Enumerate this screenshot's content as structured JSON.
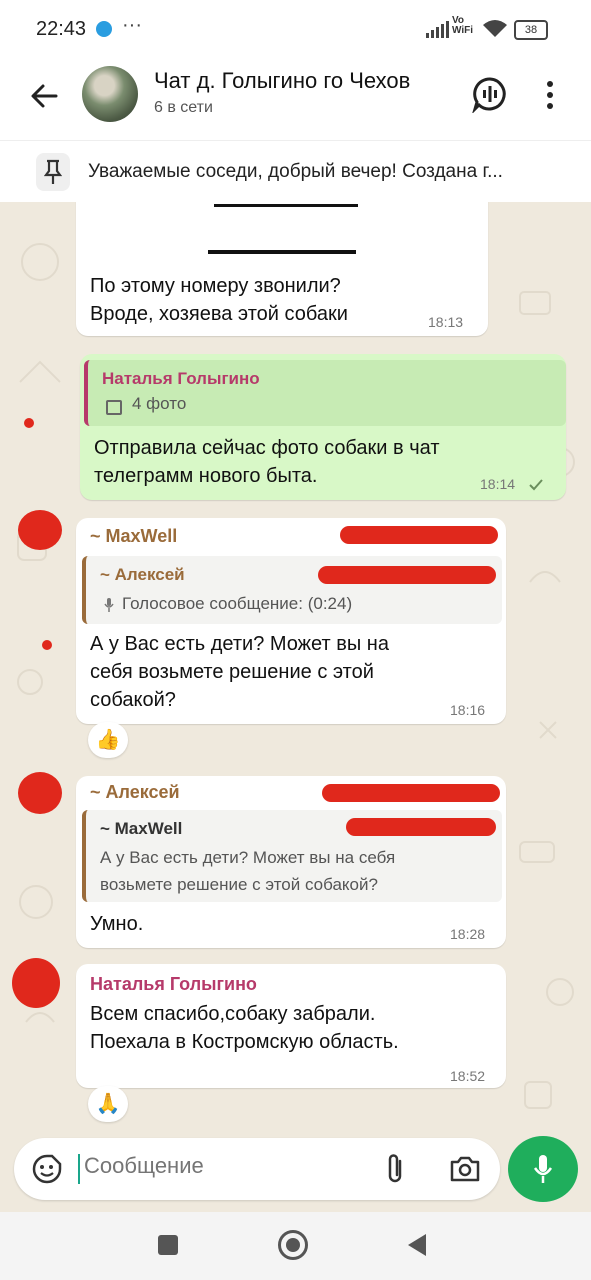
{
  "status_bar": {
    "time": "22:43",
    "dots": "···",
    "network": "Vo\nWiFi",
    "battery": "38"
  },
  "header": {
    "title": "Чат д. Голыгино го Чехов",
    "subtitle": "6 в сети"
  },
  "pinned": {
    "text": "Уважаемые соседи, добрый вечер! Создана г..."
  },
  "messages": [
    {
      "text_lines": [
        "По этому номеру звонили?",
        "Вроде, хозяева этой собаки"
      ],
      "time": "18:13"
    },
    {
      "quote_name": "Наталья Голыгино",
      "quote_text": "4 фото",
      "text_lines": [
        "Отправила сейчас фото собаки в чат",
        "телеграмм нового быта."
      ],
      "time": "18:14"
    },
    {
      "sender": "~ MaxWell",
      "quote_name": "~ Алексей",
      "quote_text": "Голосовое сообщение: (0:24)",
      "text_lines": [
        "А у Вас есть дети? Может вы на",
        "себя возьмете решение с этой",
        "собакой?"
      ],
      "time": "18:16",
      "reaction": "👍"
    },
    {
      "sender": "~ Алексей",
      "quote_name": "~ MaxWell",
      "quote_text_lines": [
        "А у Вас есть дети? Может вы на себя",
        "возьмете решение с этой собакой?"
      ],
      "text_lines": [
        "Умно."
      ],
      "time": "18:28"
    },
    {
      "sender": "Наталья Голыгино",
      "text_lines": [
        "Всем спасибо,собаку забрали.",
        "Поехала в Костромскую область."
      ],
      "time": "18:52",
      "reaction": "🙏"
    }
  ],
  "composer": {
    "placeholder": "Сообщение"
  },
  "colors": {
    "accent_green": "#1fae5c",
    "outgoing_bubble": "#d8f8c7",
    "redaction": "#e0281c",
    "sender_maxwell": "#9a6b3a",
    "sender_alexey": "#9a6b3a",
    "sender_natalia": "#b63a6a"
  }
}
